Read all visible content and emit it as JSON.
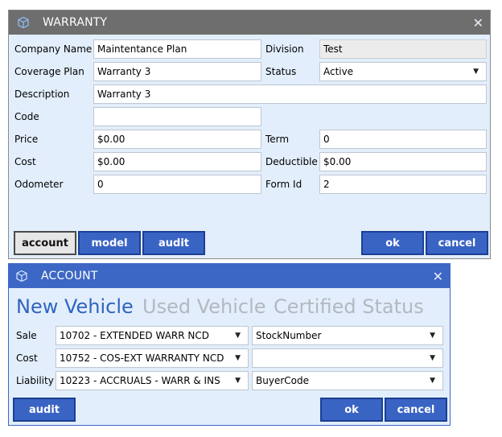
{
  "colors": {
    "titlebar_active": "#6e6e6e",
    "titlebar_account": "#3d67c5",
    "panel_bg": "#e2eefb",
    "button_blue": "#3a64c4",
    "tab_active": "#2f64c0",
    "tab_inactive": "#b3b8c0"
  },
  "warranty": {
    "title": "WARRANTY",
    "close": "✕",
    "labels": {
      "company_name": "Company Name",
      "coverage_plan": "Coverage Plan",
      "description": "Description",
      "code": "Code",
      "price": "Price",
      "cost": "Cost",
      "odometer": "Odometer",
      "division": "Division",
      "status": "Status",
      "term": "Term",
      "deductible": "Deductible",
      "form_id": "Form Id"
    },
    "values": {
      "company_name": "Maintentance Plan",
      "coverage_plan": "Warranty 3",
      "description": "Warranty 3",
      "code": "",
      "price": "$0.00",
      "cost": "$0.00",
      "odometer": "0",
      "division": "Test",
      "status": "Active",
      "term": "0",
      "deductible": "$0.00",
      "form_id": "2"
    },
    "buttons": {
      "account": "account",
      "model": "model",
      "audit": "audit",
      "ok": "ok",
      "cancel": "cancel"
    }
  },
  "account": {
    "title": "ACCOUNT",
    "close": "✕",
    "tabs": [
      "New Vehicle",
      "Used Vehicle",
      "Certified Status"
    ],
    "active_tab": "New Vehicle",
    "rows": [
      {
        "label": "Sale",
        "account": "10702 - EXTENDED WARR NCD",
        "field": "StockNumber"
      },
      {
        "label": "Cost",
        "account": "10752 - COS-EXT WARRANTY NCD",
        "field": ""
      },
      {
        "label": "Liability",
        "account": "10223 - ACCRUALS - WARR & INS",
        "field": "BuyerCode"
      }
    ],
    "buttons": {
      "audit": "audit",
      "ok": "ok",
      "cancel": "cancel"
    }
  }
}
